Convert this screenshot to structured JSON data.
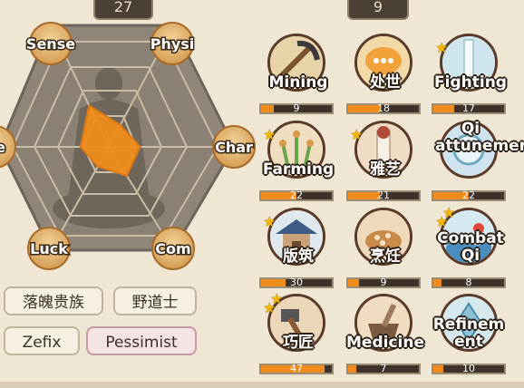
{
  "top": {
    "left_value": "27",
    "right_value": "9"
  },
  "radar": {
    "labels": {
      "top_left": "Sense",
      "top_right": "Physi",
      "right": "Char",
      "bottom_right": "Com",
      "bottom_left": "Luck",
      "left": "e"
    },
    "values": [
      0.34,
      0.18,
      0.25,
      0.28,
      0.19,
      0.26
    ]
  },
  "traits": [
    {
      "label": "落魄贵族",
      "negative": false
    },
    {
      "label": "野道士",
      "negative": false
    },
    {
      "label": "Zefix",
      "negative": false
    },
    {
      "label": "Pessimist",
      "negative": true
    }
  ],
  "skills": [
    {
      "name": "Mining",
      "value": "9",
      "fill": 0.18,
      "icon": "pickaxe-icon",
      "stars": 0
    },
    {
      "name": "处世",
      "value": "18",
      "fill": 0.45,
      "icon": "speech-bubble-icon",
      "stars": 0
    },
    {
      "name": "Fighting",
      "value": "17",
      "fill": 0.3,
      "icon": "sword-icon",
      "stars": 1
    },
    {
      "name": "Farming",
      "value": "22",
      "fill": 0.5,
      "icon": "grain-icon",
      "stars": 1
    },
    {
      "name": "雅艺",
      "value": "21",
      "fill": 0.45,
      "icon": "scroll-icon",
      "stars": 1
    },
    {
      "name": "Qi attunement",
      "value": "22",
      "fill": 0.5,
      "icon": "qi-icon",
      "stars": 0
    },
    {
      "name": "版筑",
      "value": "30",
      "fill": 0.35,
      "icon": "building-icon",
      "stars": 1
    },
    {
      "name": "烹饪",
      "value": "9",
      "fill": 0.15,
      "icon": "cooking-icon",
      "stars": 0
    },
    {
      "name": "Combat Qi",
      "value": "8",
      "fill": 0.12,
      "icon": "wave-icon",
      "stars": 2
    },
    {
      "name": "巧匠",
      "value": "47",
      "fill": 0.9,
      "icon": "hammer-icon",
      "stars": 2
    },
    {
      "name": "Medicine",
      "value": "7",
      "fill": 0.12,
      "icon": "mortar-icon",
      "stars": 0
    },
    {
      "name": "Refinement",
      "value": "10",
      "fill": 0.14,
      "icon": "refine-icon",
      "stars": 0
    }
  ],
  "colors": {
    "accent": "#f08c1c",
    "hex_dark": "#8a7f70",
    "bg": "#efe6d4"
  }
}
